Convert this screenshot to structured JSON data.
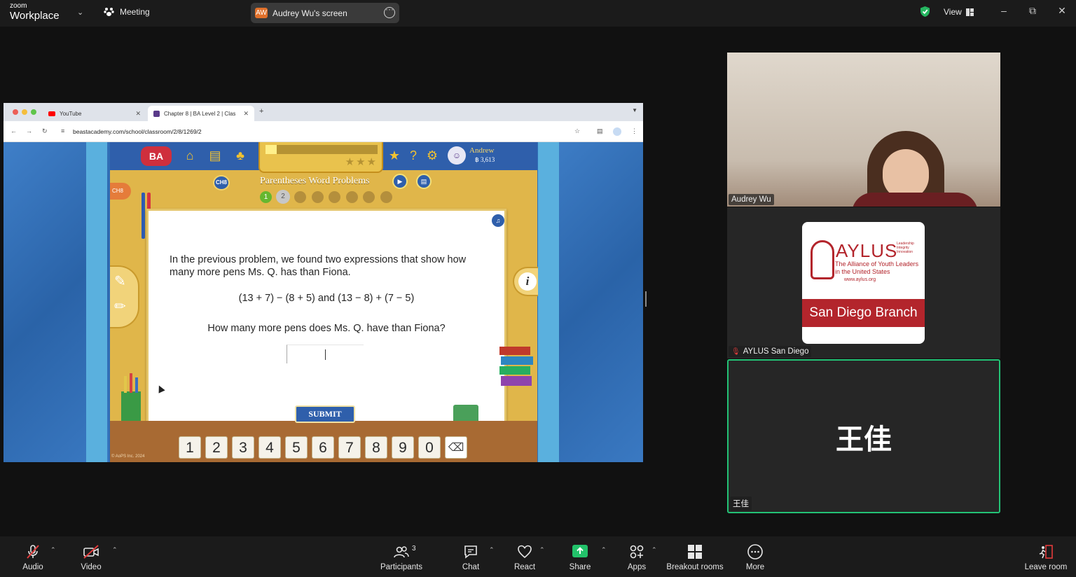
{
  "topbar": {
    "logo_small": "zoom",
    "logo_big": "Workplace",
    "meeting_label": "Meeting",
    "screen_initials": "AW",
    "screen_label": "Audrey Wu's screen",
    "view_label": "View"
  },
  "browser": {
    "tabs": [
      {
        "label": "YouTube"
      },
      {
        "label": "Chapter 8 | BA Level 2 | Clas"
      }
    ],
    "url": "beastacademy.com/school/classroom/2/8/1269/2"
  },
  "game": {
    "logo": "BA",
    "user_name": "Andrew",
    "user_coins": "3,613",
    "chapter_badge": "CH8",
    "lesson_title": "Parentheses Word Problems",
    "progress_dots": [
      "1",
      "2",
      "",
      "",
      "",
      "",
      "",
      ""
    ],
    "progress_fill": 0.1,
    "stars_earned": 0,
    "stars_total": 3,
    "side_clip": "CH8",
    "question_text": "In the previous problem, we found two expressions that show how many more pens Ms. Q. has than Fiona.",
    "expression": "(13 + 7) − (8 + 5)  and  (13 − 8) + (7 − 5)",
    "question_prompt": "How many more pens does Ms. Q. have than Fiona?",
    "answer_value": "",
    "submit_label": "SUBMIT",
    "keypad": [
      "1",
      "2",
      "3",
      "4",
      "5",
      "6",
      "7",
      "8",
      "9",
      "0"
    ],
    "copyright": "© AoPS Inc. 2024"
  },
  "participants_tiles": [
    {
      "name": "Audrey Wu"
    },
    {
      "name": "AYLUS San Diego",
      "logo_title": "AYLUS",
      "logo_mini": "Leadership Integrity Innovation",
      "logo_subtitle": "The Alliance of Youth Leaders in the United States",
      "logo_url": "www.aylus.org",
      "logo_band": "San Diego Branch"
    },
    {
      "name": "王佳",
      "display": "王佳"
    }
  ],
  "toolbar": {
    "audio": "Audio",
    "video": "Video",
    "participants": "Participants",
    "participants_count": "3",
    "chat": "Chat",
    "react": "React",
    "share": "Share",
    "apps": "Apps",
    "breakout": "Breakout rooms",
    "more": "More",
    "leave": "Leave room"
  },
  "colors": {
    "accent_green": "#23c275",
    "share_green": "#22c26a",
    "mute_red": "#e23b3b",
    "aylus_red": "#b3252c"
  }
}
